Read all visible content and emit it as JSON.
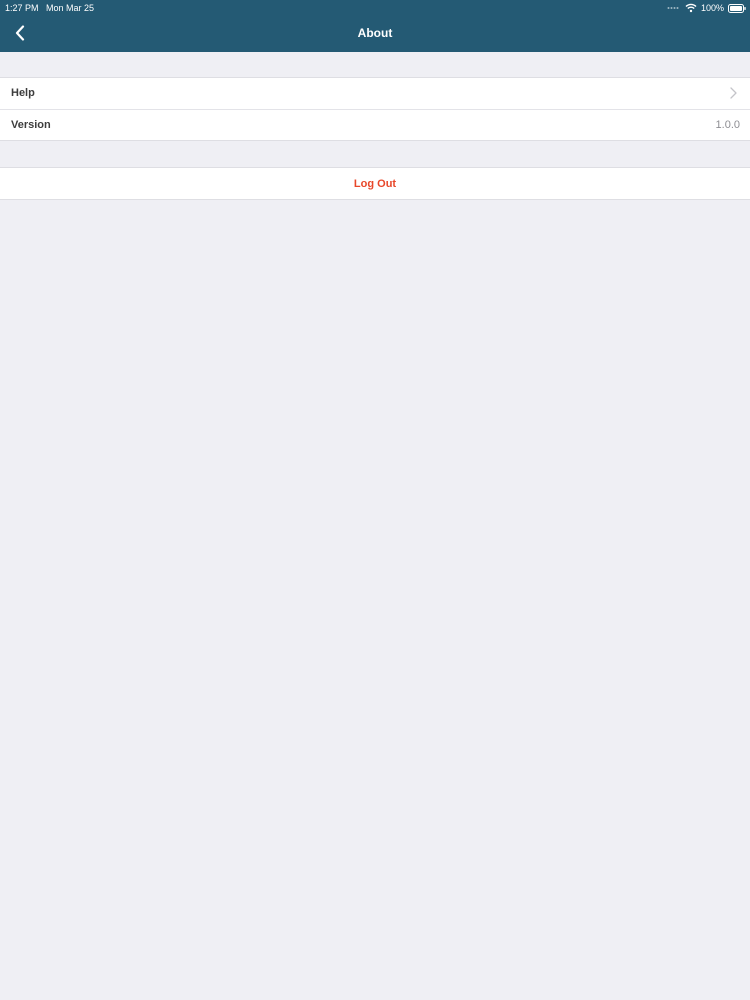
{
  "status_bar": {
    "time": "1:27 PM",
    "date": "Mon Mar 25",
    "battery": "100%",
    "icons": [
      "cellular-signal-icon",
      "wifi-icon",
      "battery-icon"
    ]
  },
  "nav": {
    "title": "About",
    "back_icon": "chevron-left-icon"
  },
  "settings": {
    "rows": [
      {
        "label": "Help",
        "icon": "chevron-right-icon"
      },
      {
        "label": "Version",
        "value": "1.0.0"
      }
    ]
  },
  "actions": {
    "logout_label": "Log Out"
  },
  "colors": {
    "header_bg": "#245a74",
    "page_bg": "#efeff4",
    "destructive": "#e8472a"
  }
}
